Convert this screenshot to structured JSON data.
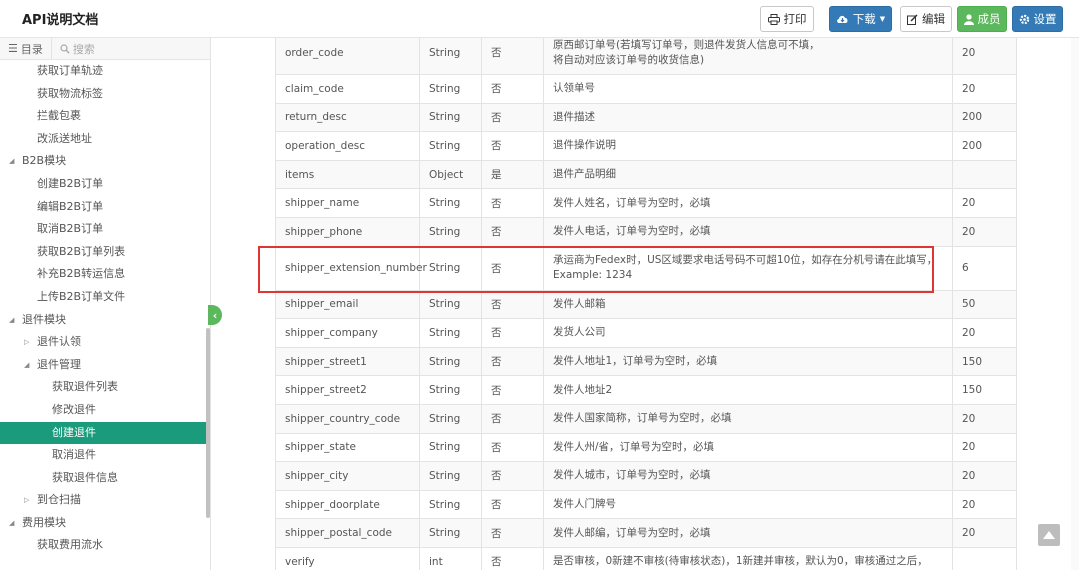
{
  "app": {
    "title": "API说明文档"
  },
  "toolbar": {
    "print_label": "打印",
    "download_label": "下载",
    "edit_label": "编辑",
    "members_label": "成员",
    "settings_label": "设置"
  },
  "colors": {
    "primary": "#337ab7",
    "success": "#5cb85c",
    "active_item": "#1a9b7b",
    "highlight": "#e03535"
  },
  "sidebar": {
    "tabs": {
      "toc": "目录",
      "search": "搜索"
    },
    "items": [
      {
        "label": "获取订单轨迹",
        "level": 2
      },
      {
        "label": "获取物流标签",
        "level": 2
      },
      {
        "label": "拦截包裹",
        "level": 2
      },
      {
        "label": "改派送地址",
        "level": 2
      },
      {
        "label": "B2B模块",
        "level": 1,
        "expanded": true
      },
      {
        "label": "创建B2B订单",
        "level": 2
      },
      {
        "label": "编辑B2B订单",
        "level": 2
      },
      {
        "label": "取消B2B订单",
        "level": 2
      },
      {
        "label": "获取B2B订单列表",
        "level": 2
      },
      {
        "label": "补充B2B转运信息",
        "level": 2
      },
      {
        "label": "上传B2B订单文件",
        "level": 2
      },
      {
        "label": "退件模块",
        "level": 1,
        "expanded": true
      },
      {
        "label": "退件认领",
        "level": 2,
        "expanded": false
      },
      {
        "label": "退件管理",
        "level": 2,
        "expanded": true
      },
      {
        "label": "获取退件列表",
        "level": 3
      },
      {
        "label": "修改退件",
        "level": 3
      },
      {
        "label": "创建退件",
        "level": 3,
        "active": true
      },
      {
        "label": "取消退件",
        "level": 3
      },
      {
        "label": "获取退件信息",
        "level": 3
      },
      {
        "label": "到仓扫描",
        "level": 2,
        "expanded": false
      },
      {
        "label": "费用模块",
        "level": 1,
        "expanded": true
      },
      {
        "label": "获取费用流水",
        "level": 2
      }
    ]
  },
  "table": {
    "rows": [
      {
        "name": "order_code",
        "type": "String",
        "required": "否",
        "desc": [
          "原西邮订单号(若填写订单号，则退件发货人信息可不填，",
          "将自动对应该订单号的收货信息)"
        ],
        "len": "20"
      },
      {
        "name": "claim_code",
        "type": "String",
        "required": "否",
        "desc": [
          "认领单号"
        ],
        "len": "20"
      },
      {
        "name": "return_desc",
        "type": "String",
        "required": "否",
        "desc": [
          "退件描述"
        ],
        "len": "200"
      },
      {
        "name": "operation_desc",
        "type": "String",
        "required": "否",
        "desc": [
          "退件操作说明"
        ],
        "len": "200"
      },
      {
        "name": "items",
        "type": "Object",
        "required": "是",
        "desc": [
          "退件产品明细"
        ],
        "len": ""
      },
      {
        "name": "shipper_name",
        "type": "String",
        "required": "否",
        "desc": [
          "发件人姓名，订单号为空时，必填"
        ],
        "len": "20"
      },
      {
        "name": "shipper_phone",
        "type": "String",
        "required": "否",
        "desc": [
          "发件人电话，订单号为空时，必填"
        ],
        "len": "20"
      },
      {
        "name": "shipper_extension_number",
        "type": "String",
        "required": "否",
        "desc": [
          "承运商为Fedex时，US区域要求电话号码不可超10位，如存在分机号请在此填写，",
          "Example: 1234"
        ],
        "len": "6"
      },
      {
        "name": "shipper_email",
        "type": "String",
        "required": "否",
        "desc": [
          "发件人邮箱"
        ],
        "len": "50"
      },
      {
        "name": "shipper_company",
        "type": "String",
        "required": "否",
        "desc": [
          "发货人公司"
        ],
        "len": "20"
      },
      {
        "name": "shipper_street1",
        "type": "String",
        "required": "否",
        "desc": [
          "发件人地址1，订单号为空时，必填"
        ],
        "len": "150"
      },
      {
        "name": "shipper_street2",
        "type": "String",
        "required": "否",
        "desc": [
          "发件人地址2"
        ],
        "len": "150"
      },
      {
        "name": "shipper_country_code",
        "type": "String",
        "required": "否",
        "desc": [
          "发件人国家简称，订单号为空时，必填"
        ],
        "len": "20"
      },
      {
        "name": "shipper_state",
        "type": "String",
        "required": "否",
        "desc": [
          "发件人州/省，订单号为空时，必填"
        ],
        "len": "20"
      },
      {
        "name": "shipper_city",
        "type": "String",
        "required": "否",
        "desc": [
          "发件人城市，订单号为空时，必填"
        ],
        "len": "20"
      },
      {
        "name": "shipper_doorplate",
        "type": "String",
        "required": "否",
        "desc": [
          "发件人门牌号"
        ],
        "len": "20"
      },
      {
        "name": "shipper_postal_code",
        "type": "String",
        "required": "否",
        "desc": [
          "发件人邮编，订单号为空时，必填"
        ],
        "len": "20"
      },
      {
        "name": "verify",
        "type": "int",
        "required": "否",
        "desc": [
          "是否审核，0新建不审核(待审核状态)，1新建并审核，默认为0，审核通过之后，"
        ],
        "len": ""
      }
    ]
  }
}
